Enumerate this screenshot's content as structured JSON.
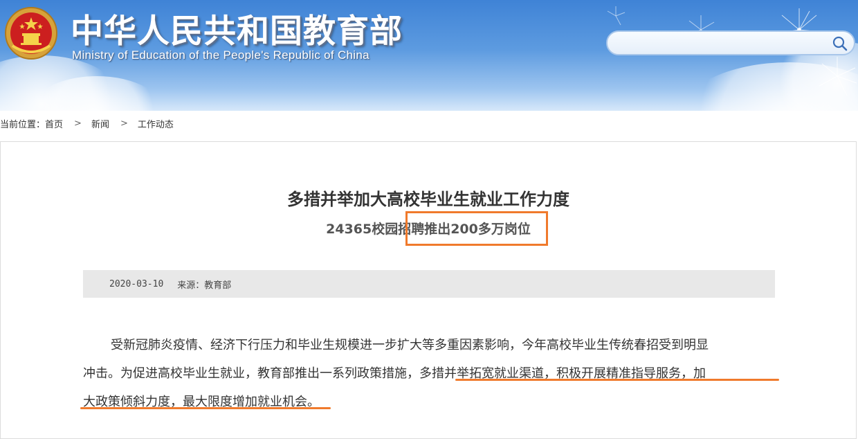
{
  "header": {
    "title": "中华人民共和国教育部",
    "subtitle": "Ministry of Education of the People's Republic of China",
    "search": {
      "placeholder": "",
      "value": ""
    },
    "search_icon": "search-icon",
    "emblem_icon": "national-emblem-icon"
  },
  "breadcrumb": {
    "prefix": "当前位置：",
    "items": [
      "首页",
      "新闻",
      "工作动态"
    ],
    "separator": ">"
  },
  "article": {
    "title": "多措并举加大高校毕业生就业工作力度",
    "subtitle": "24365校园招聘推出200多万岗位",
    "date": "2020-03-10",
    "source": "来源：教育部",
    "paragraph_lines": [
      "受新冠肺炎疫情、经济下行压力和毕业生规模进一步扩大等多重因素影响，今年高校毕业生传统春招受到明显",
      "冲击。为促进高校毕业生就业，教育部推出一系列政策措施，多措并举拓宽就业渠道，积极开展精准指导服务，加",
      "大政策倾斜力度，最大限度增加就业机会。"
    ]
  },
  "colors": {
    "banner_blue": "#3f83d6",
    "highlight_orange": "#f07a2c",
    "meta_bar_gray": "#e8e8e8",
    "text_dark": "#333333"
  }
}
